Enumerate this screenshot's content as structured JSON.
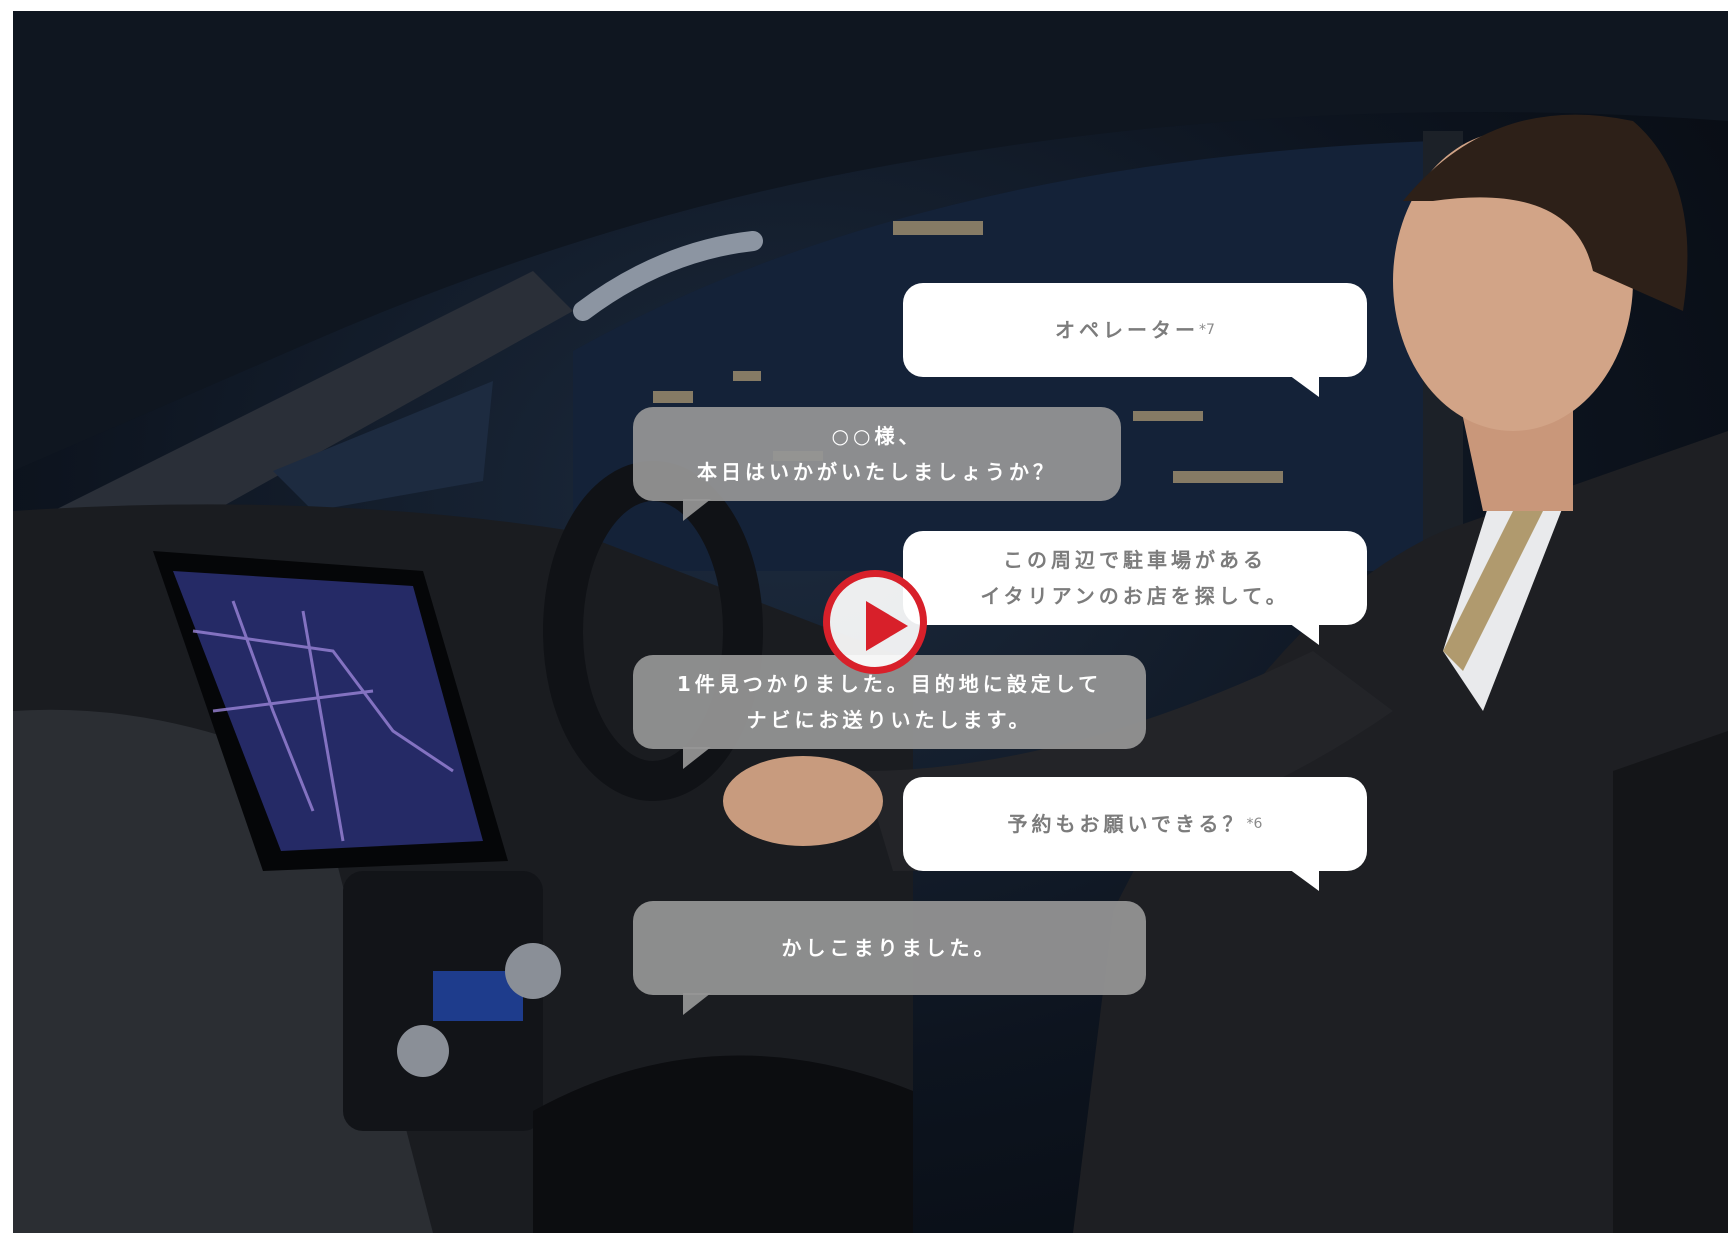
{
  "scene": {
    "alt_icon": "car-interior-photo",
    "colors": {
      "accent": "#d8202a",
      "operator_bubble": "#969696",
      "user_bubble": "#ffffff",
      "user_text": "#7c7c7c"
    }
  },
  "conversation": [
    {
      "speaker": "user",
      "text": "オペレーター",
      "note": "*7"
    },
    {
      "speaker": "operator",
      "text": "○○様、\n本日はいかがいたしましょうか？"
    },
    {
      "speaker": "user",
      "text": "この周辺で駐車場がある\nイタリアンのお店を探して。"
    },
    {
      "speaker": "operator",
      "text": "1件見つかりました。目的地に設定して\nナビにお送りいたします。"
    },
    {
      "speaker": "user",
      "text": "予約もお願いできる？",
      "note": "*6"
    },
    {
      "speaker": "operator",
      "text": "かしこまりました。"
    }
  ],
  "play_button": {
    "icon": "play-icon",
    "color": "#d8202a"
  }
}
